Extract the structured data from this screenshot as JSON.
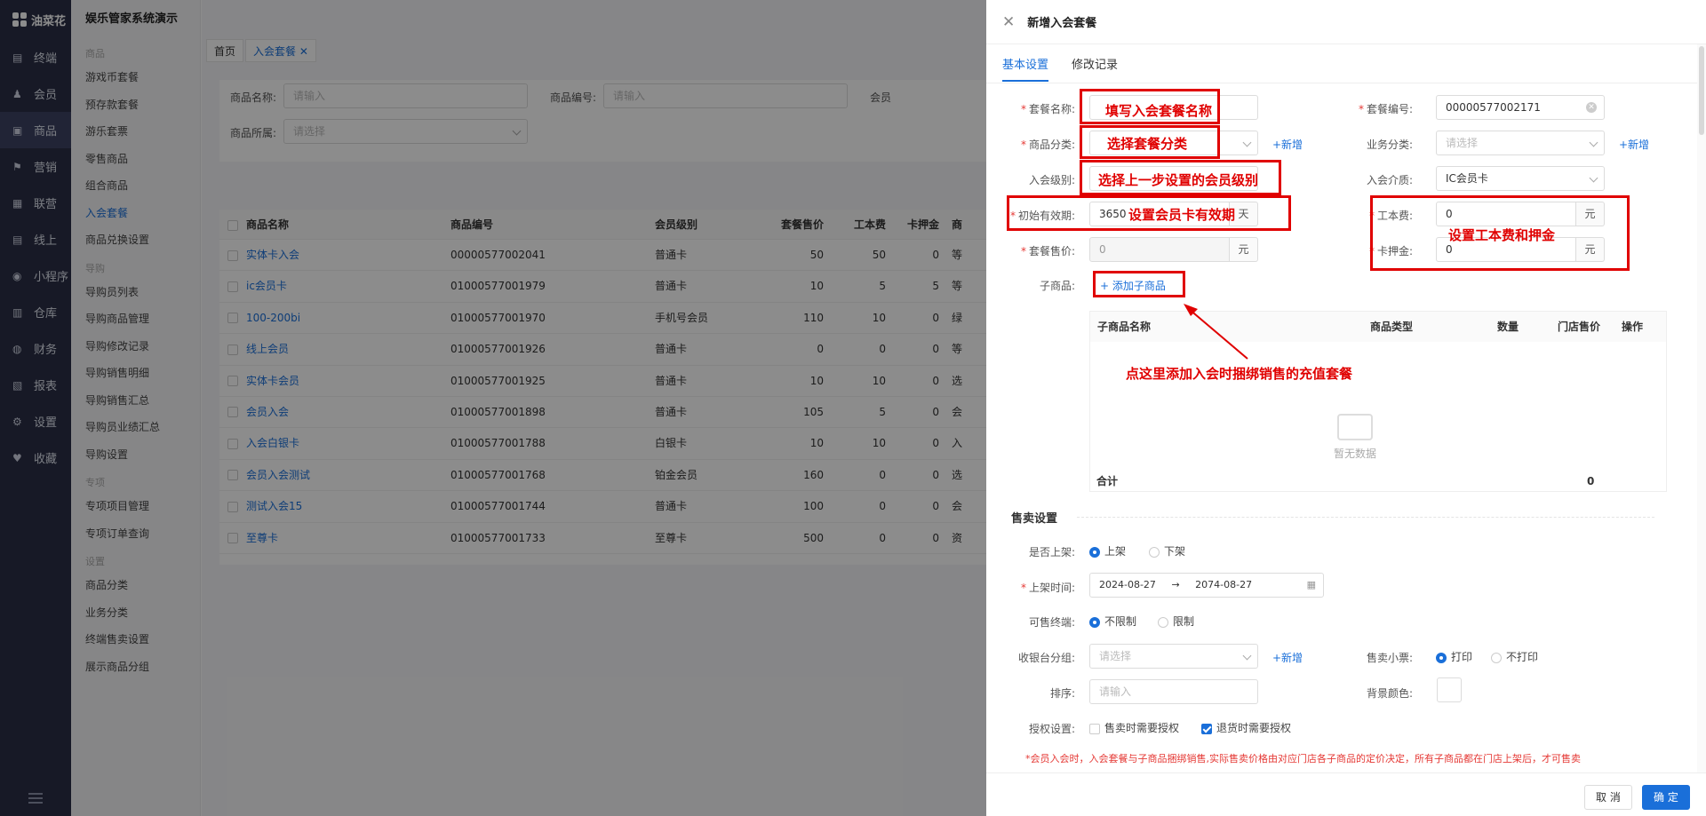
{
  "app": {
    "logo": "油菜花",
    "title": "娱乐管家系统演示"
  },
  "rail": [
    {
      "label": "终端",
      "icon": "terminal-icon"
    },
    {
      "label": "会员",
      "icon": "user-icon"
    },
    {
      "label": "商品",
      "icon": "goods-icon"
    },
    {
      "label": "营销",
      "icon": "flag-icon"
    },
    {
      "label": "联营",
      "icon": "grid-icon"
    },
    {
      "label": "线上",
      "icon": "calendar-icon"
    },
    {
      "label": "小程序",
      "icon": "miniprogram-icon"
    },
    {
      "label": "仓库",
      "icon": "warehouse-icon"
    },
    {
      "label": "财务",
      "icon": "finance-icon"
    },
    {
      "label": "报表",
      "icon": "report-icon"
    },
    {
      "label": "设置",
      "icon": "gear-icon"
    },
    {
      "label": "收藏",
      "icon": "heart-icon"
    }
  ],
  "submenu": {
    "g1": "商品",
    "g1_items": [
      "游戏币套餐",
      "预存款套餐",
      "游乐套票",
      "零售商品",
      "组合商品",
      "入会套餐",
      "商品兑换设置"
    ],
    "g2": "导购",
    "g2_items": [
      "导购员列表",
      "导购商品管理",
      "导购修改记录",
      "导购销售明细",
      "导购销售汇总",
      "导购员业绩汇总",
      "导购设置"
    ],
    "g3": "专项",
    "g3_items": [
      "专项项目管理",
      "专项订单查询"
    ],
    "g4": "设置",
    "g4_items": [
      "商品分类",
      "业务分类",
      "终端售卖设置",
      "展示商品分组"
    ]
  },
  "tabs": [
    "首页",
    "入会套餐 ✕"
  ],
  "filter": {
    "name_label": "商品名称:",
    "name_ph": "请输入",
    "code_label": "商品编号:",
    "code_ph": "请输入",
    "belong_label": "商品所属:",
    "belong_ph": "请选择",
    "more_label": "会员"
  },
  "table": {
    "headers": [
      "商品名称",
      "商品编号",
      "会员级别",
      "套餐售价",
      "工本费",
      "卡押金",
      "商"
    ],
    "rows": [
      [
        "实体卡入会",
        "00000577002041",
        "普通卡",
        "50",
        "50",
        "0",
        "等"
      ],
      [
        "ic会员卡",
        "01000577001979",
        "普通卡",
        "10",
        "5",
        "5",
        "等"
      ],
      [
        "100-200bi",
        "01000577001970",
        "手机号会员",
        "110",
        "10",
        "0",
        "绿"
      ],
      [
        "线上会员",
        "01000577001926",
        "普通卡",
        "0",
        "0",
        "0",
        "等"
      ],
      [
        "实体卡会员",
        "01000577001925",
        "普通卡",
        "10",
        "10",
        "0",
        "选"
      ],
      [
        "会员入会",
        "01000577001898",
        "普通卡",
        "105",
        "5",
        "0",
        "会"
      ],
      [
        "入会白银卡",
        "01000577001788",
        "白银卡",
        "10",
        "10",
        "0",
        "入"
      ],
      [
        "会员入会测试",
        "01000577001768",
        "铂金会员",
        "160",
        "0",
        "0",
        "选"
      ],
      [
        "测试入会15",
        "01000577001744",
        "普通卡",
        "100",
        "0",
        "0",
        "会"
      ],
      [
        "至尊卡",
        "01000577001733",
        "至尊卡",
        "500",
        "0",
        "0",
        "资"
      ]
    ]
  },
  "drawer": {
    "title": "新增入会套餐",
    "tabs": [
      "基本设置",
      "修改记录"
    ],
    "pkg_name_label": "套餐名称:",
    "pkg_code_label": "套餐编号:",
    "pkg_code_value": "00000577002171",
    "category_label": "商品分类:",
    "add_new": "+新增",
    "biz_label": "业务分类:",
    "biz_ph": "请选择",
    "level_label": "入会级别:",
    "medium_label": "入会介质:",
    "medium_value": "IC会员卡",
    "validity_label": "初始有效期:",
    "validity_value": "3650",
    "validity_unit": "天",
    "fee_label": "工本费:",
    "fee_value": "0",
    "yuan": "元",
    "price_label": "套餐售价:",
    "price_value": "0",
    "deposit_label": "卡押金:",
    "deposit_value": "0",
    "sub_label": "子商品:",
    "add_sub": "+ 添加子商品",
    "sub_headers": [
      "子商品名称",
      "商品类型",
      "数量",
      "门店售价",
      "操作"
    ],
    "empty": "暂无数据",
    "total_label": "合计",
    "total_value": "0",
    "sale_section": "售卖设置",
    "onshelf_label": "是否上架:",
    "onshelf_yes": "上架",
    "onshelf_no": "下架",
    "shelf_time_label": "上架时间:",
    "date_start": "2024-08-27",
    "date_arrow": "→",
    "date_end": "2074-08-27",
    "terminal_label": "可售终端:",
    "terminal_unlimited": "不限制",
    "terminal_limited": "限制",
    "cashier_label": "收银台分组:",
    "cashier_ph": "请选择",
    "ticket_label": "售卖小票:",
    "ticket_print": "打印",
    "ticket_noprint": "不打印",
    "sort_label": "排序:",
    "sort_ph": "请输入",
    "bg_label": "背景颜色:",
    "auth_label": "授权设置:",
    "auth_sale": "售卖时需要授权",
    "auth_return": "退货时需要授权",
    "footnote": "*会员入会时，入会套餐与子商品捆绑销售,实际售卖价格由对应门店各子商品的定价决定，所有子商品都在门店上架后，才可售卖",
    "cancel": "取 消",
    "ok": "确 定"
  },
  "annotations": {
    "a1": "填写入会套餐名称",
    "a2": "选择套餐分类",
    "a3": "选择上一步设置的会员级别",
    "a4": "设置会员卡有效期",
    "a5": "设置工本费和押金",
    "a6": "点这里添加入会时捆绑销售的充值套餐"
  },
  "colors": {
    "accent": "#1a6fd9",
    "annotation": "#e00000",
    "rail": "#2b2f45"
  }
}
